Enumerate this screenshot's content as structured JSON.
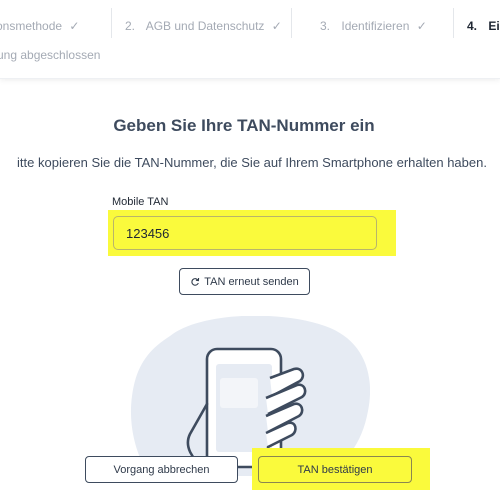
{
  "stepper": {
    "steps": [
      {
        "number": "",
        "label": "onsmethode",
        "completed": true
      },
      {
        "number": "2.",
        "label": "AGB und Datenschutz",
        "completed": true
      },
      {
        "number": "3.",
        "label": "Identifizieren",
        "completed": true
      },
      {
        "number": "4.",
        "label": "Eir",
        "completed": false
      }
    ],
    "check_symbol": "✓",
    "subtitle": "ung abgeschlossen"
  },
  "main": {
    "title": "Geben Sie Ihre TAN-Nummer ein",
    "instruction": "itte kopieren Sie die TAN-Nummer, die Sie auf Ihrem Smartphone erhalten haben."
  },
  "tan_field": {
    "label": "Mobile TAN",
    "value": "123456"
  },
  "resend_button": {
    "label": "TAN erneut senden",
    "icon": "refresh-icon"
  },
  "actions": {
    "cancel_label": "Vorgang abbrechen",
    "confirm_label": "TAN bestätigen"
  },
  "colors": {
    "highlight": "#fafa3c",
    "text_dark": "#3e4b5e",
    "step_inactive": "#a4aab4",
    "illustration_blob": "#e6ebf3"
  }
}
